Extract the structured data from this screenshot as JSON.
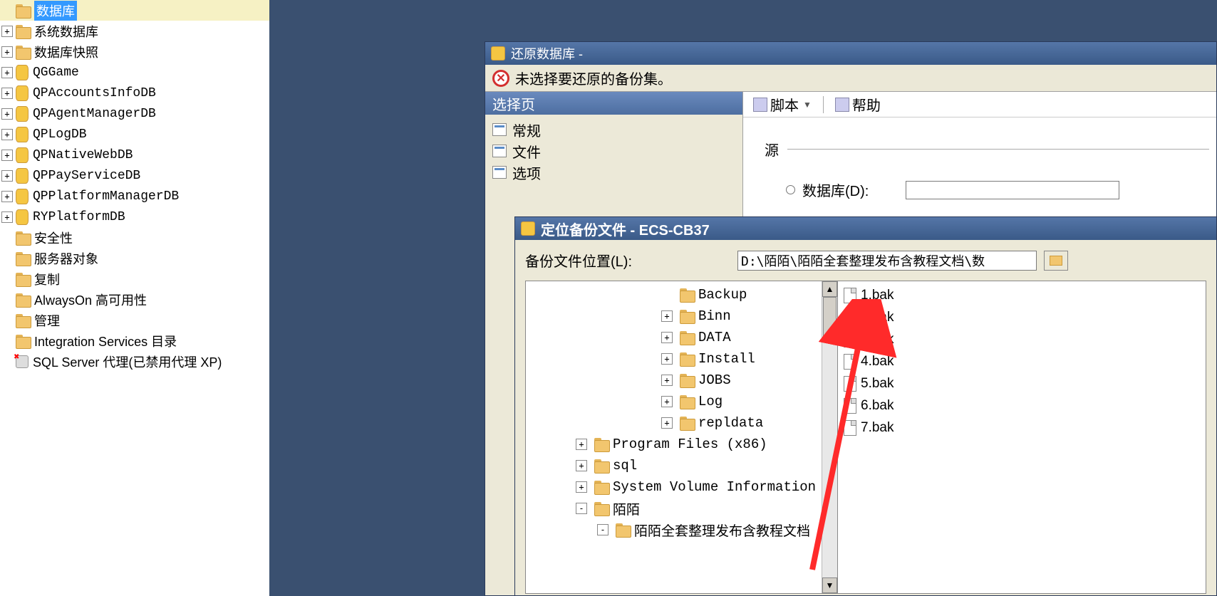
{
  "left_tree": {
    "root": "数据库",
    "items": [
      {
        "icon": "folder",
        "label": "系统数据库",
        "exp": "+"
      },
      {
        "icon": "folder",
        "label": "数据库快照",
        "exp": "+"
      },
      {
        "icon": "db",
        "label": "QGGame",
        "exp": "+",
        "mono": true
      },
      {
        "icon": "db",
        "label": "QPAccountsInfoDB",
        "exp": "+",
        "mono": true
      },
      {
        "icon": "db",
        "label": "QPAgentManagerDB",
        "exp": "+",
        "mono": true
      },
      {
        "icon": "db",
        "label": "QPLogDB",
        "exp": "+",
        "mono": true
      },
      {
        "icon": "db",
        "label": "QPNativeWebDB",
        "exp": "+",
        "mono": true
      },
      {
        "icon": "db",
        "label": "QPPayServiceDB",
        "exp": "+",
        "mono": true
      },
      {
        "icon": "db",
        "label": "QPPlatformManagerDB",
        "exp": "+",
        "mono": true
      },
      {
        "icon": "db",
        "label": "RYPlatformDB",
        "exp": "+",
        "mono": true
      },
      {
        "icon": "folder",
        "label": "安全性",
        "exp": ""
      },
      {
        "icon": "folder",
        "label": "服务器对象",
        "exp": ""
      },
      {
        "icon": "folder",
        "label": "复制",
        "exp": ""
      },
      {
        "icon": "folder",
        "label": "AlwaysOn 高可用性",
        "exp": ""
      },
      {
        "icon": "folder",
        "label": "管理",
        "exp": ""
      },
      {
        "icon": "folder",
        "label": "Integration Services 目录",
        "exp": ""
      },
      {
        "icon": "agent",
        "label": "SQL Server 代理(已禁用代理 XP)",
        "exp": ""
      }
    ]
  },
  "restore": {
    "title": "还原数据库 -",
    "error": "未选择要还原的备份集。",
    "select_page_header": "选择页",
    "pages": [
      "常规",
      "文件",
      "选项"
    ],
    "script_btn": "脚本",
    "help_btn": "帮助",
    "source_label": "源",
    "db_radio": "数据库(D):"
  },
  "locate": {
    "title": "定位备份文件 - ECS-CB37",
    "path_label": "备份文件位置(L):",
    "path_value": "D:\\陌陌\\陌陌全套整理发布含教程文档\\数",
    "folders": [
      {
        "pad": 190,
        "exp": "",
        "label": "Backup",
        "mono": true
      },
      {
        "pad": 190,
        "exp": "+",
        "label": "Binn",
        "mono": true
      },
      {
        "pad": 190,
        "exp": "+",
        "label": "DATA",
        "mono": true
      },
      {
        "pad": 190,
        "exp": "+",
        "label": "Install",
        "mono": true
      },
      {
        "pad": 190,
        "exp": "+",
        "label": "JOBS",
        "mono": true
      },
      {
        "pad": 190,
        "exp": "+",
        "label": "Log",
        "mono": true
      },
      {
        "pad": 190,
        "exp": "+",
        "label": "repldata",
        "mono": true
      },
      {
        "pad": 70,
        "exp": "+",
        "label": "Program Files (x86)",
        "mono": true
      },
      {
        "pad": 70,
        "exp": "+",
        "label": "sql",
        "mono": true
      },
      {
        "pad": 70,
        "exp": "+",
        "label": "System Volume Information",
        "mono": true
      },
      {
        "pad": 70,
        "exp": "-",
        "label": "陌陌",
        "mono": false
      },
      {
        "pad": 100,
        "exp": "-",
        "label": "陌陌全套整理发布含教程文档",
        "mono": false
      }
    ],
    "files": [
      "1.bak",
      "2.bak",
      "3.bak",
      "4.bak",
      "5.bak",
      "6.bak",
      "7.bak"
    ]
  }
}
